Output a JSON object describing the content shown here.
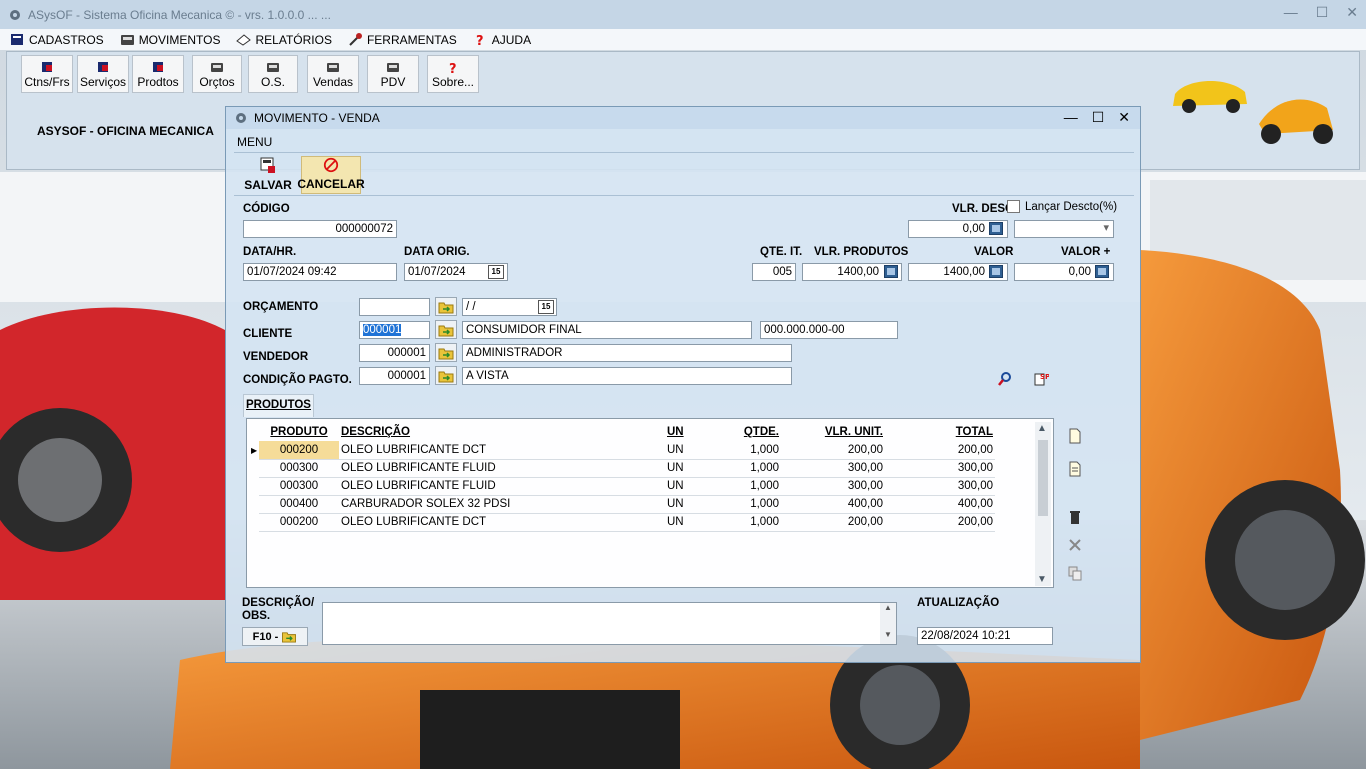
{
  "window": {
    "title": "ASysOF - Sistema Oficina Mecanica © - vrs. 1.0.0.0 ... ..."
  },
  "menu": [
    "CADASTROS",
    "MOVIMENTOS",
    "RELATÓRIOS",
    "FERRAMENTAS",
    "AJUDA"
  ],
  "toolbar": [
    "Ctns/Frs",
    "Serviços",
    "Prodtos",
    "Orçtos",
    "O.S.",
    "Vendas",
    "PDV",
    "Sobre..."
  ],
  "company": "ASYSOF - OFICINA MECANICA",
  "dialog": {
    "title": "MOVIMENTO - VENDA",
    "menu": "MENU",
    "save_label": "SALVAR",
    "cancel_label": "CANCELAR"
  },
  "form": {
    "codigo_label": "CÓDIGO",
    "codigo": "000000072",
    "vlr_desc_label": "VLR. DESC.",
    "vlr_desc": "0,00",
    "lancar_desc_label": "Lançar Descto(%)",
    "data_hr_label": "DATA/HR.",
    "data_hr": "01/07/2024 09:42",
    "data_orig_label": "DATA ORIG.",
    "data_orig": "01/07/2024",
    "qte_it_label": "QTE. IT.",
    "qte_it": "005",
    "vlr_produtos_label": "VLR. PRODUTOS",
    "vlr_produtos": "1400,00",
    "valor_label": "VALOR",
    "valor": "1400,00",
    "valor_mais_label": "VALOR +",
    "valor_mais": "0,00",
    "orcamento_label": "ORÇAMENTO",
    "orcamento_code": "",
    "orcamento_date": " / /",
    "cliente_label": "CLIENTE",
    "cliente_code": "000001",
    "cliente_name": "CONSUMIDOR FINAL",
    "cliente_doc": "000.000.000-00",
    "vendedor_label": "VENDEDOR",
    "vendedor_code": "000001",
    "vendedor_name": "ADMINISTRADOR",
    "condicao_label": "CONDIÇÃO PAGTO.",
    "condicao_code": "000001",
    "condicao_name": "A VISTA",
    "tab_produtos": "PRODUTOS",
    "obs_label": "DESCRIÇÃO/\nOBS.",
    "f10_label": "F10 -",
    "atualizacao_label": "ATUALIZAÇÃO",
    "atualizacao": "22/08/2024 10:21"
  },
  "grid": {
    "headers": [
      "PRODUTO",
      "DESCRIÇÃO",
      "UN",
      "QTDE.",
      "VLR. UNIT.",
      "TOTAL"
    ],
    "rows": [
      [
        "000200",
        "OLEO LUBRIFICANTE DCT",
        "UN",
        "1,000",
        "200,00",
        "200,00"
      ],
      [
        "000300",
        "OLEO LUBRIFICANTE FLUID",
        "UN",
        "1,000",
        "300,00",
        "300,00"
      ],
      [
        "000300",
        "OLEO LUBRIFICANTE FLUID",
        "UN",
        "1,000",
        "300,00",
        "300,00"
      ],
      [
        "000400",
        "CARBURADOR SOLEX 32 PDSI",
        "UN",
        "1,000",
        "400,00",
        "400,00"
      ],
      [
        "000200",
        "OLEO LUBRIFICANTE DCT",
        "UN",
        "1,000",
        "200,00",
        "200,00"
      ]
    ]
  },
  "colors": {
    "accent_selected": "#1f73d6",
    "current_cell": "#f5dc99",
    "car_orange": "#e8731e",
    "car_red": "#d2262b"
  }
}
